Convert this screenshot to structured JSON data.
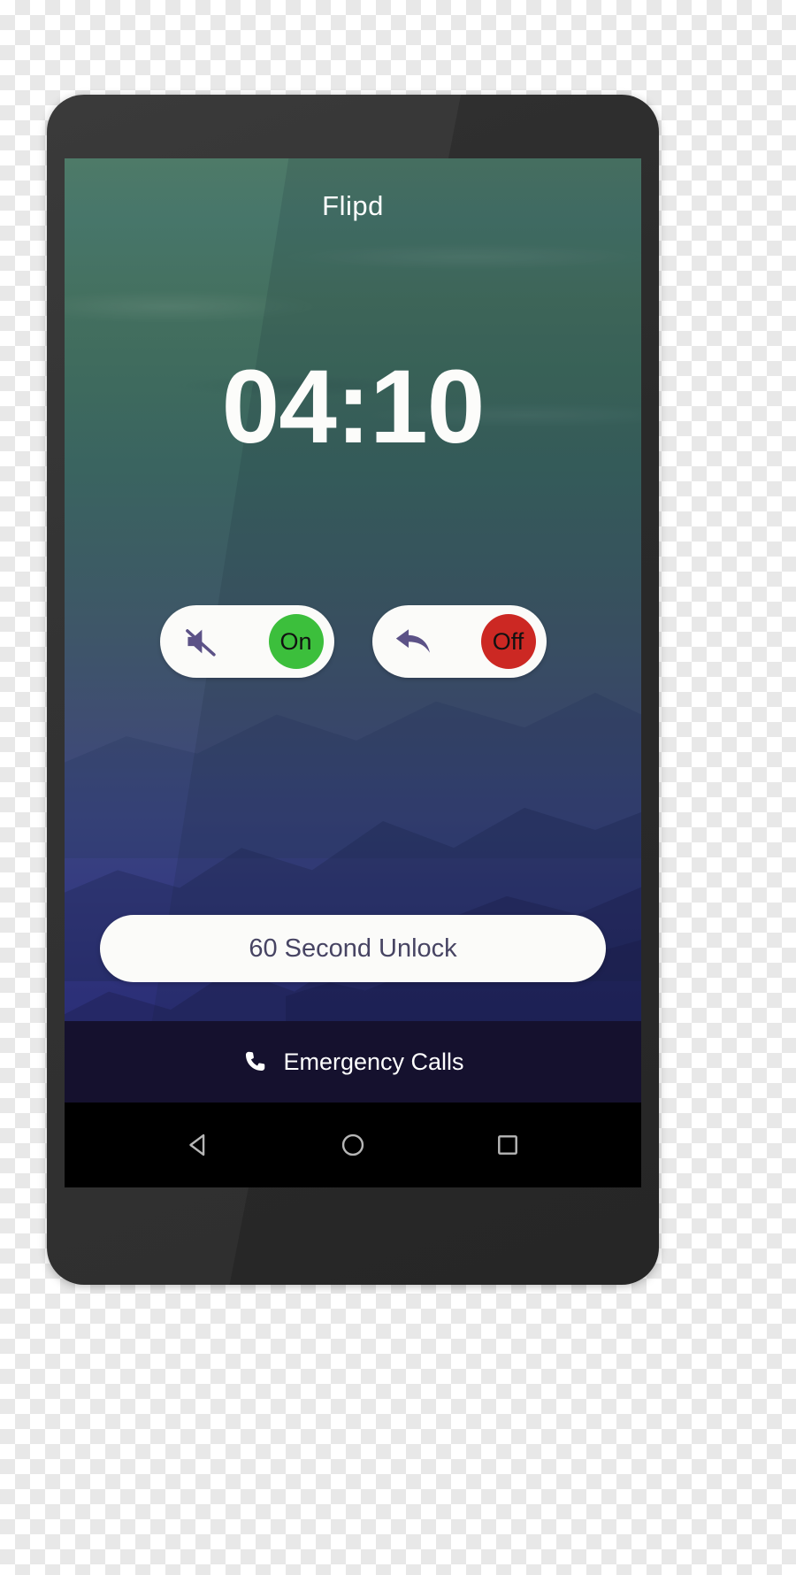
{
  "app": {
    "title": "Flipd"
  },
  "lockscreen": {
    "clock": "04:10",
    "toggles": [
      {
        "name": "silent-mode",
        "icon": "mute-icon",
        "state_label": "On",
        "state_color": "#3cbf3c"
      },
      {
        "name": "auto-reply",
        "icon": "reply-arrow-icon",
        "state_label": "Off",
        "state_color": "#cc2823"
      }
    ],
    "unlock_button_label": "60 Second Unlock",
    "emergency": {
      "icon": "phone-handset-icon",
      "label": "Emergency Calls"
    }
  },
  "navbar": {
    "back": "back-triangle-icon",
    "home": "home-circle-icon",
    "recents": "recents-square-icon"
  },
  "colors": {
    "wallpaper_top": "#4e7a68",
    "wallpaper_bottom": "#221f58",
    "pill_background": "#fbfbf9",
    "on_green": "#3cbf3c",
    "off_red": "#cc2823",
    "icon_purple": "#5c5287",
    "unlock_text": "#474463",
    "emergency_bar": "#15112e",
    "navbar": "#000000",
    "device_body": "#333333"
  }
}
